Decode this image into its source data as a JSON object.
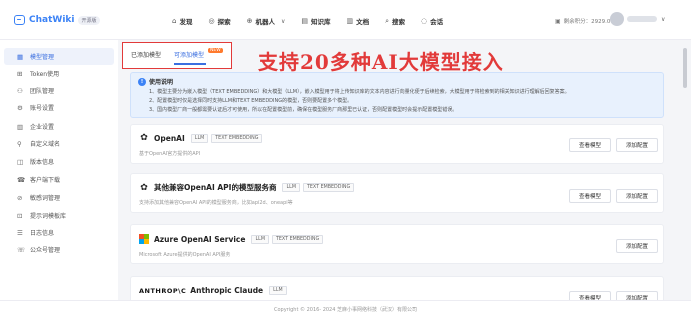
{
  "app": {
    "name": "ChatWiki",
    "badge": "开源版"
  },
  "topnav": [
    {
      "icon": "⌂",
      "label": "发现",
      "caret": false
    },
    {
      "icon": "◎",
      "label": "探索",
      "caret": false
    },
    {
      "icon": "⊕",
      "label": "机器人",
      "caret": true
    },
    {
      "icon": "▤",
      "label": "知识库",
      "caret": false
    },
    {
      "icon": "▥",
      "label": "文档",
      "caret": false
    },
    {
      "icon": "⌕",
      "label": "搜索",
      "caret": false
    },
    {
      "icon": "◌",
      "label": "会话",
      "caret": false
    }
  ],
  "credits": {
    "label": "剩余积分：2929.000"
  },
  "sidebar": [
    {
      "icon": "▦",
      "label": "模型管理",
      "active": true
    },
    {
      "icon": "⊞",
      "label": "Token使用",
      "active": false
    },
    {
      "icon": "⚇",
      "label": "团队管理",
      "active": false
    },
    {
      "icon": "⚙",
      "label": "账号设置",
      "active": false
    },
    {
      "icon": "▥",
      "label": "企业设置",
      "active": false
    },
    {
      "icon": "⚲",
      "label": "自定义域名",
      "active": false
    },
    {
      "icon": "◫",
      "label": "版本信息",
      "active": false
    },
    {
      "icon": "☎",
      "label": "客户端下载",
      "active": false
    },
    {
      "icon": "⊘",
      "label": "敏感词管理",
      "active": false
    },
    {
      "icon": "⊡",
      "label": "提示词模板库",
      "active": false
    },
    {
      "icon": "☰",
      "label": "日志信息",
      "active": false
    },
    {
      "icon": "☏",
      "label": "公众号管理",
      "active": false
    }
  ],
  "tabs": {
    "added": "已添加模型",
    "available": "可添加模型",
    "badge": "NEW"
  },
  "promo": "支持20多种AI大模型接入",
  "info": {
    "title": "使用说明",
    "lines": [
      "1、模型主要分为嵌入模型（TEXT EMBEDDING）和大模型（LLM），嵌入模型用于将上传知识库的文本内容进行向量化便于后续检索，大模型用于将检索到的相关知识进行理解后回复答案。",
      "2、配置模型时仅是选择同时支持LLM和TEXT EMBEDDING的模型，否则要配置多个模型。",
      "3、国内模型厂商一般都需要认证后才可使用，所以在配置模型前，确保在模型服务厂商那里已认证，否则配置模型时会提示配置模型错误。"
    ]
  },
  "providers": [
    {
      "name": "OpenAI",
      "logo": "openai-icon",
      "tags": [
        "LLM",
        "TEXT EMBEDDING"
      ],
      "desc": "基于OpenAI官方提供的API",
      "buttons": [
        "查看模型",
        "添加配置"
      ]
    },
    {
      "name": "其他兼容OpenAI API的模型服务商",
      "logo": "openai-icon",
      "tags": [
        "LLM",
        "TEXT EMBEDDING"
      ],
      "desc": "支持添加其他兼容OpenAI API的模型服务商，比如api2d、oneapi等",
      "buttons": [
        "查看模型",
        "添加配置"
      ]
    },
    {
      "name": "Azure OpenAI Service",
      "logo": "microsoft-icon",
      "tags": [
        "LLM",
        "TEXT EMBEDDING"
      ],
      "desc": "Microsoft Azure提供的OpenAI API服务",
      "buttons": [
        "添加配置"
      ]
    },
    {
      "name": "Anthropic Claude",
      "logo_text": "ANTHROP\\C",
      "logo": "anthropic-icon",
      "tags": [
        "LLM"
      ],
      "desc": "",
      "buttons": [
        "查看模型",
        "添加配置"
      ]
    }
  ],
  "footer": "Copyright © 2016- 2024 芝麻小事网络科技（武汉）有限公司",
  "colors": {
    "accent": "#3b6fe0",
    "annotation": "#e23a3a",
    "brand": "#3b82f6"
  }
}
